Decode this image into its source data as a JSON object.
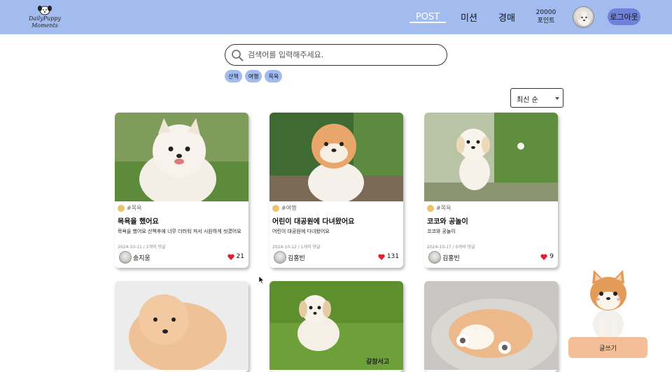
{
  "header": {
    "logo_text_line1": "DailyPuppy",
    "logo_text_line2": "Moments",
    "nav": {
      "post": "POST",
      "mission": "미션",
      "auction": "경매"
    },
    "points_value": "20000",
    "points_label": "포인트",
    "logout_label": "로그아웃"
  },
  "search": {
    "placeholder": "검색어를 입력해주세요.",
    "value": ""
  },
  "tags": [
    "산책",
    "여행",
    "목욕"
  ],
  "sort": {
    "selected": "최신 순"
  },
  "posts": [
    {
      "category": "#목욕",
      "title": "목욕을 했어요",
      "body": "목욕을 했어요 산책후에 너무 더러워 져서 시원하게 씻겼어요",
      "meta": "2024-10-11 / 2개의 댓글",
      "author": "송지웅",
      "likes": "21"
    },
    {
      "category": "#여행",
      "title": "어린이 대공원에 다녀왔어요",
      "body": "어린이 대공원에 다녀왔어요",
      "meta": "2024-10-12 / 1개의 댓글",
      "author": "김홍빈",
      "likes": "131"
    },
    {
      "category": "#목욕",
      "title": "코코와 공놀이",
      "body": "코코와 공놀이",
      "meta": "2024-10-17 / 0개의 댓글",
      "author": "김홍빈",
      "likes": "9"
    }
  ],
  "watermark_text": "갈참서고",
  "write_button_label": "글쓰기",
  "colors": {
    "header_bg": "#a3bcef",
    "logout_bg": "#6f82d9",
    "write_bg": "#f4bf98",
    "heart": "#e0202e"
  }
}
